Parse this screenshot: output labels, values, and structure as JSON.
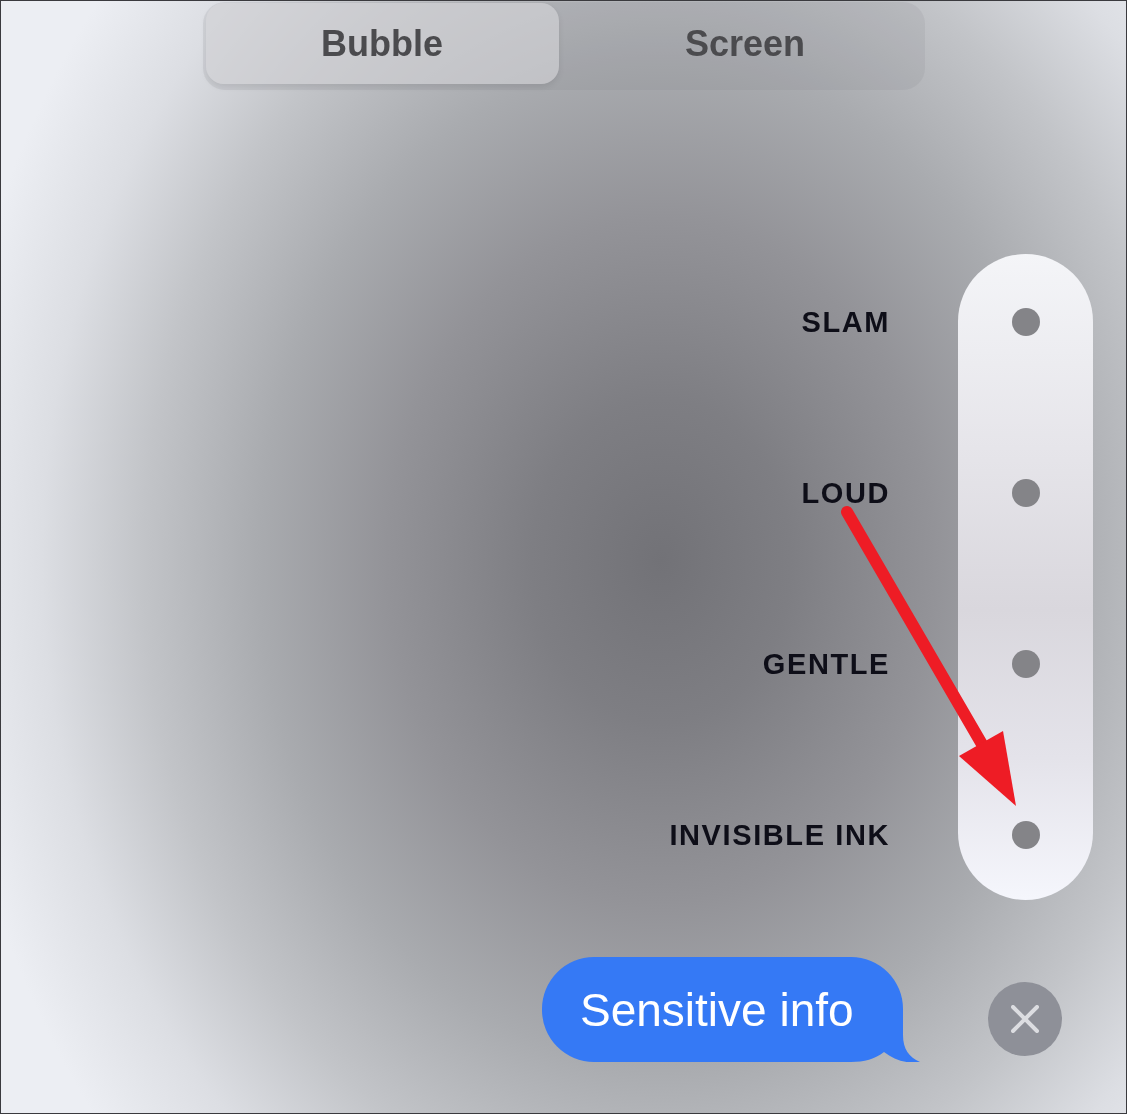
{
  "tabs": [
    {
      "label": "Bubble",
      "selected": true
    },
    {
      "label": "Screen",
      "selected": false
    }
  ],
  "effects": [
    {
      "label": "SLAM",
      "selected": false
    },
    {
      "label": "LOUD",
      "selected": false
    },
    {
      "label": "GENTLE",
      "selected": false
    },
    {
      "label": "INVISIBLE INK",
      "selected": false
    }
  ],
  "message_bubble": {
    "text": "Sensitive info"
  }
}
